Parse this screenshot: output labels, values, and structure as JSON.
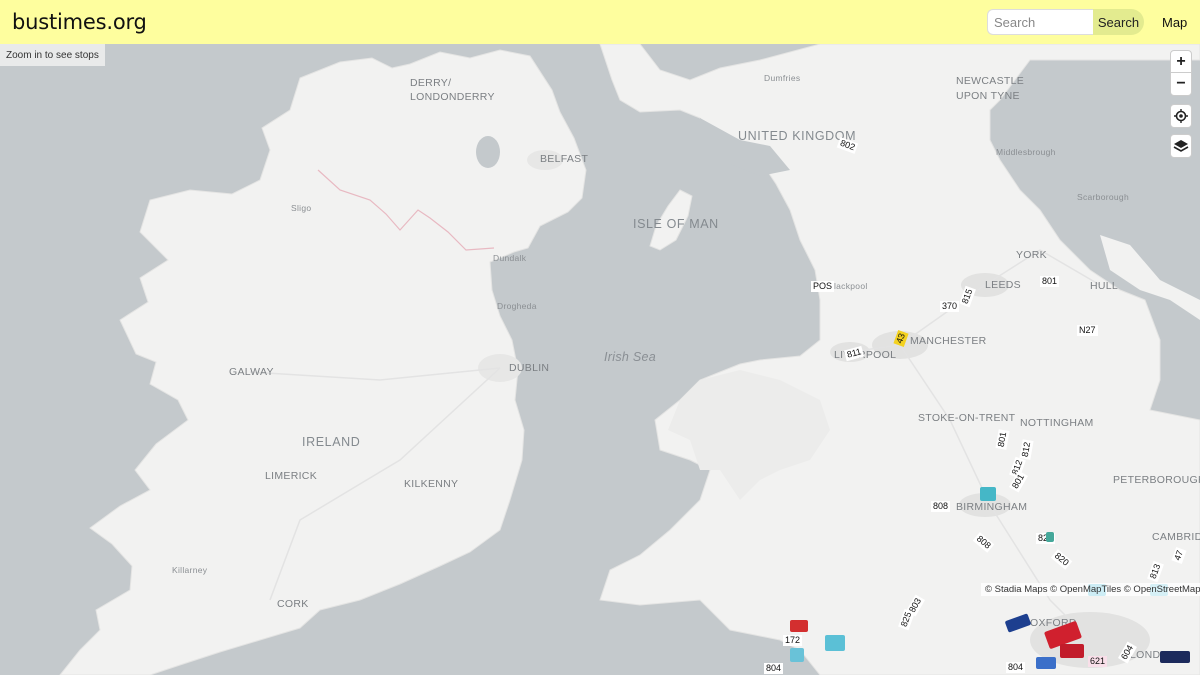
{
  "header": {
    "brand": "bustimes.org",
    "search_placeholder": "Search",
    "search_button": "Search",
    "nav_map": "Map"
  },
  "map": {
    "zoom_hint": "Zoom in to see stops",
    "attribution": "© Stadia Maps © OpenMapTiles © OpenStreetMap",
    "controls": {
      "zoom_in": "+",
      "zoom_out": "−"
    },
    "colors": {
      "sea": "#c4c9cc",
      "land": "#f2f2f1",
      "header": "#fefe9e",
      "search_button": "#e3eb8f"
    },
    "places": [
      {
        "name": "DERRY/",
        "class": "city"
      },
      {
        "name": "LONDONDERRY",
        "class": "city"
      },
      {
        "name": "BELFAST",
        "class": "city"
      },
      {
        "name": "Sligo",
        "class": "small"
      },
      {
        "name": "Dundalk",
        "class": "small"
      },
      {
        "name": "Drogheda",
        "class": "small"
      },
      {
        "name": "DUBLIN",
        "class": "city"
      },
      {
        "name": "GALWAY",
        "class": "city"
      },
      {
        "name": "IRELAND",
        "class": "country"
      },
      {
        "name": "LIMERICK",
        "class": "city"
      },
      {
        "name": "KILKENNY",
        "class": "city"
      },
      {
        "name": "Killarney",
        "class": "small"
      },
      {
        "name": "CORK",
        "class": "city"
      },
      {
        "name": "ISLE OF MAN",
        "class": "country"
      },
      {
        "name": "Irish Sea",
        "class": "sea"
      },
      {
        "name": "Dumfries",
        "class": "small"
      },
      {
        "name": "UNITED KINGDOM",
        "class": "country"
      },
      {
        "name": "NEWCASTLE",
        "class": "city"
      },
      {
        "name": "UPON TYNE",
        "class": "city"
      },
      {
        "name": "Middlesbrough",
        "class": "small"
      },
      {
        "name": "Scarborough",
        "class": "small"
      },
      {
        "name": "YORK",
        "class": "city"
      },
      {
        "name": "LEEDS",
        "class": "city"
      },
      {
        "name": "HULL",
        "class": "city"
      },
      {
        "name": "Blackpool",
        "class": "small"
      },
      {
        "name": "MANCHESTER",
        "class": "city"
      },
      {
        "name": "LIVERPOOL",
        "class": "city"
      },
      {
        "name": "STOKE-ON-TRENT",
        "class": "city"
      },
      {
        "name": "NOTTINGHAM",
        "class": "city"
      },
      {
        "name": "PETERBOROUGH",
        "class": "city"
      },
      {
        "name": "BIRMINGHAM",
        "class": "city"
      },
      {
        "name": "CAMBRIDGE",
        "class": "city"
      },
      {
        "name": "OXFORD",
        "class": "city"
      },
      {
        "name": "LONDON",
        "class": "city"
      }
    ],
    "buses": [
      "802",
      "801",
      "370",
      "815",
      "811",
      "43",
      "801",
      "812",
      "812",
      "801",
      "808",
      "808",
      "820",
      "820",
      "803",
      "825",
      "804",
      "172",
      "804",
      "604",
      "621",
      "47",
      "813",
      "N27",
      "POS"
    ]
  }
}
